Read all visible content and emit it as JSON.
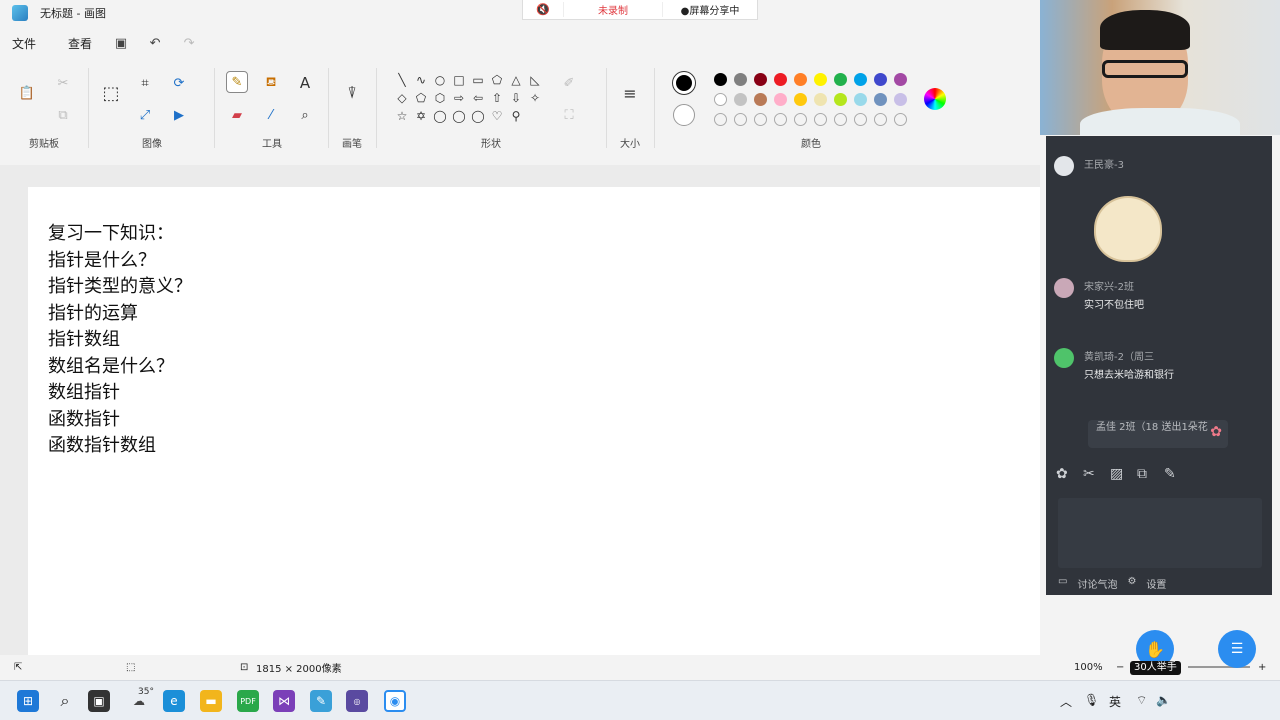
{
  "window": {
    "title": "无标题 - 画图"
  },
  "meeting_bar": {
    "mic_icon": "muted-mic-icon",
    "record_status": "未录制",
    "share_status": "●屏幕分享中"
  },
  "menu": {
    "items": [
      "文件",
      "查看"
    ]
  },
  "ribbon": {
    "groups": {
      "clipboard": "剪贴板",
      "image": "图像",
      "tools": "工具",
      "brushes": "画笔",
      "shapes": "形状",
      "size": "大小",
      "colors": "颜色"
    },
    "shapes": [
      "╲",
      "∿",
      "○",
      "□",
      "▭",
      "⬠",
      "△",
      "◺",
      "◇",
      "⬠",
      "⬡",
      "⇨",
      "⇦",
      "⇧",
      "⇩",
      "✧",
      "☆",
      "✡",
      "◯",
      "◯",
      "◯",
      "♡",
      "⚲"
    ],
    "colors": {
      "primary": "#000000",
      "secondary": "#ffffff",
      "row1": [
        "#000000",
        "#7f7f7f",
        "#880015",
        "#ed1c24",
        "#ff7f27",
        "#fff200",
        "#22b14c",
        "#00a2e8",
        "#3f48cc",
        "#a349a4"
      ],
      "row2": [
        "#ffffff",
        "#c3c3c3",
        "#b97a57",
        "#ffaec9",
        "#ffc90e",
        "#efe4b0",
        "#b5e61d",
        "#99d9ea",
        "#7092be",
        "#c8bfe7"
      ]
    }
  },
  "canvas": {
    "lines": [
      "复习一下知识：",
      "指针是什么？",
      "指针类型的意义？",
      "指针的运算",
      "指针数组",
      "数组名是什么？",
      "数组指针",
      "函数指针",
      "函数指针数组"
    ]
  },
  "statusbar": {
    "dimensions": "1815 × 2000像素",
    "zoom": "100%"
  },
  "chat": {
    "messages": [
      {
        "name": "王民豪-3",
        "text": ""
      },
      {
        "name": "宋家兴-2班",
        "text": "实习不包住吧"
      },
      {
        "name": "黄凯琦-2（周三",
        "text": "只想去米哈游和银行"
      }
    ],
    "flower_note": "孟佳 2班（18 送出1朵花",
    "footer": {
      "discussion": "讨论气泡",
      "settings": "设置"
    }
  },
  "raise_hand": {
    "count_label": "30人举手"
  },
  "taskbar": {
    "weather": "35°",
    "ime": "英"
  }
}
